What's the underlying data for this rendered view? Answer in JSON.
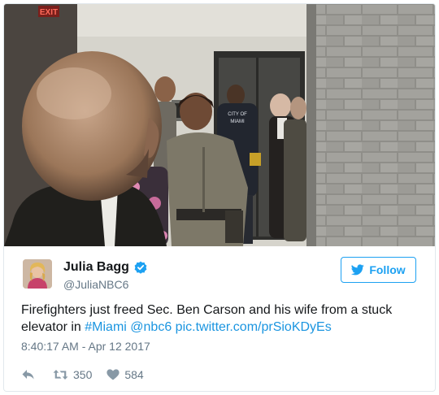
{
  "tweet": {
    "author_name": "Julia Bagg",
    "author_handle": "@JuliaNBC6",
    "follow_label": "Follow",
    "text_prefix": "Firefighters just freed Sec. Ben Carson and his wife from a stuck elevator in ",
    "hashtag": "#Miami",
    "mention": "@nbc6",
    "media_link": "pic.twitter.com/prSioKDyEs",
    "timestamp": "8:40:17 AM - Apr 12 2017",
    "retweet_count": "350",
    "like_count": "584"
  },
  "photo": {
    "exit_sign": "EXIT"
  },
  "colors": {
    "brand_blue": "#1da1f2",
    "link_blue": "#1b95e0",
    "muted_gray": "#657786",
    "icon_gray": "#8899a6",
    "heart_gray": "#8899a6"
  },
  "icons": {
    "verified": "verified-badge-icon",
    "follow": "twitter-bird-icon",
    "reply": "reply-icon",
    "retweet": "retweet-icon",
    "like": "heart-icon"
  }
}
